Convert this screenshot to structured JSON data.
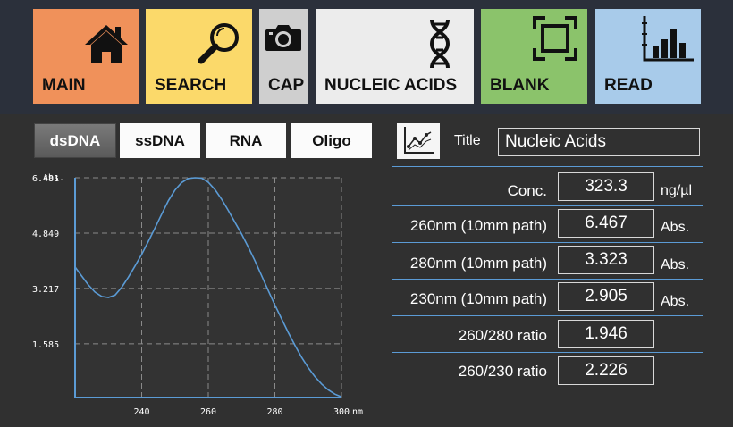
{
  "toolbar": {
    "main_label": "MAIN",
    "search_label": "SEARCH",
    "cap_label": "CAP",
    "nucleic_label": "NUCLEIC ACIDS",
    "blank_label": "BLANK",
    "read_label": "READ"
  },
  "tabs": [
    {
      "label": "dsDNA",
      "active": true
    },
    {
      "label": "ssDNA",
      "active": false
    },
    {
      "label": "RNA",
      "active": false
    },
    {
      "label": "Oligo",
      "active": false
    }
  ],
  "chart_data": {
    "type": "line",
    "title": "",
    "xlabel": "nm",
    "ylabel": "Abs.",
    "xlim": [
      220,
      300
    ],
    "ylim": [
      0,
      6.481
    ],
    "xticks": [
      "240",
      "260",
      "280",
      "300"
    ],
    "yticks": [
      "6.481",
      "4.849",
      "3.217",
      "1.585"
    ],
    "grid": true,
    "series": [
      {
        "color": "#5b9bd5",
        "x": [
          220,
          222,
          224,
          226,
          228,
          230,
          232,
          234,
          236,
          238,
          240,
          242,
          244,
          246,
          248,
          250,
          252,
          254,
          256,
          258,
          260,
          262,
          264,
          266,
          268,
          270,
          272,
          274,
          276,
          278,
          280,
          282,
          284,
          286,
          288,
          290,
          292,
          294,
          296,
          298,
          300
        ],
        "y": [
          3.85,
          3.58,
          3.32,
          3.11,
          2.98,
          2.95,
          3.02,
          3.25,
          3.55,
          3.88,
          4.22,
          4.6,
          5.0,
          5.41,
          5.8,
          6.12,
          6.34,
          6.46,
          6.48,
          6.47,
          6.35,
          6.13,
          5.85,
          5.52,
          5.17,
          4.82,
          4.44,
          4.04,
          3.6,
          3.16,
          2.73,
          2.32,
          1.92,
          1.54,
          1.19,
          0.88,
          0.62,
          0.4,
          0.23,
          0.1,
          0.02
        ]
      }
    ]
  },
  "graph_button_icon": "line-graph-icon",
  "title_field": {
    "label": "Title",
    "value": "Nucleic Acids"
  },
  "measurements": [
    {
      "label": "Conc.",
      "value": "323.3",
      "unit": "ng/µl"
    },
    {
      "label": "260nm (10mm path)",
      "value": "6.467",
      "unit": "Abs."
    },
    {
      "label": "280nm (10mm path)",
      "value": "3.323",
      "unit": "Abs."
    },
    {
      "label": "230nm (10mm path)",
      "value": "2.905",
      "unit": "Abs."
    },
    {
      "label": "260/280 ratio",
      "value": "1.946",
      "unit": ""
    },
    {
      "label": "260/230 ratio",
      "value": "2.226",
      "unit": ""
    }
  ],
  "colors": {
    "main": "#f0915a",
    "search": "#fbd96a",
    "cap": "#cfcfcf",
    "nucleic": "#ececec",
    "blank": "#8bc36b",
    "read": "#a8cbea",
    "accent": "#5b9bd5",
    "background": "#303030",
    "topbar": "#2b303b"
  }
}
